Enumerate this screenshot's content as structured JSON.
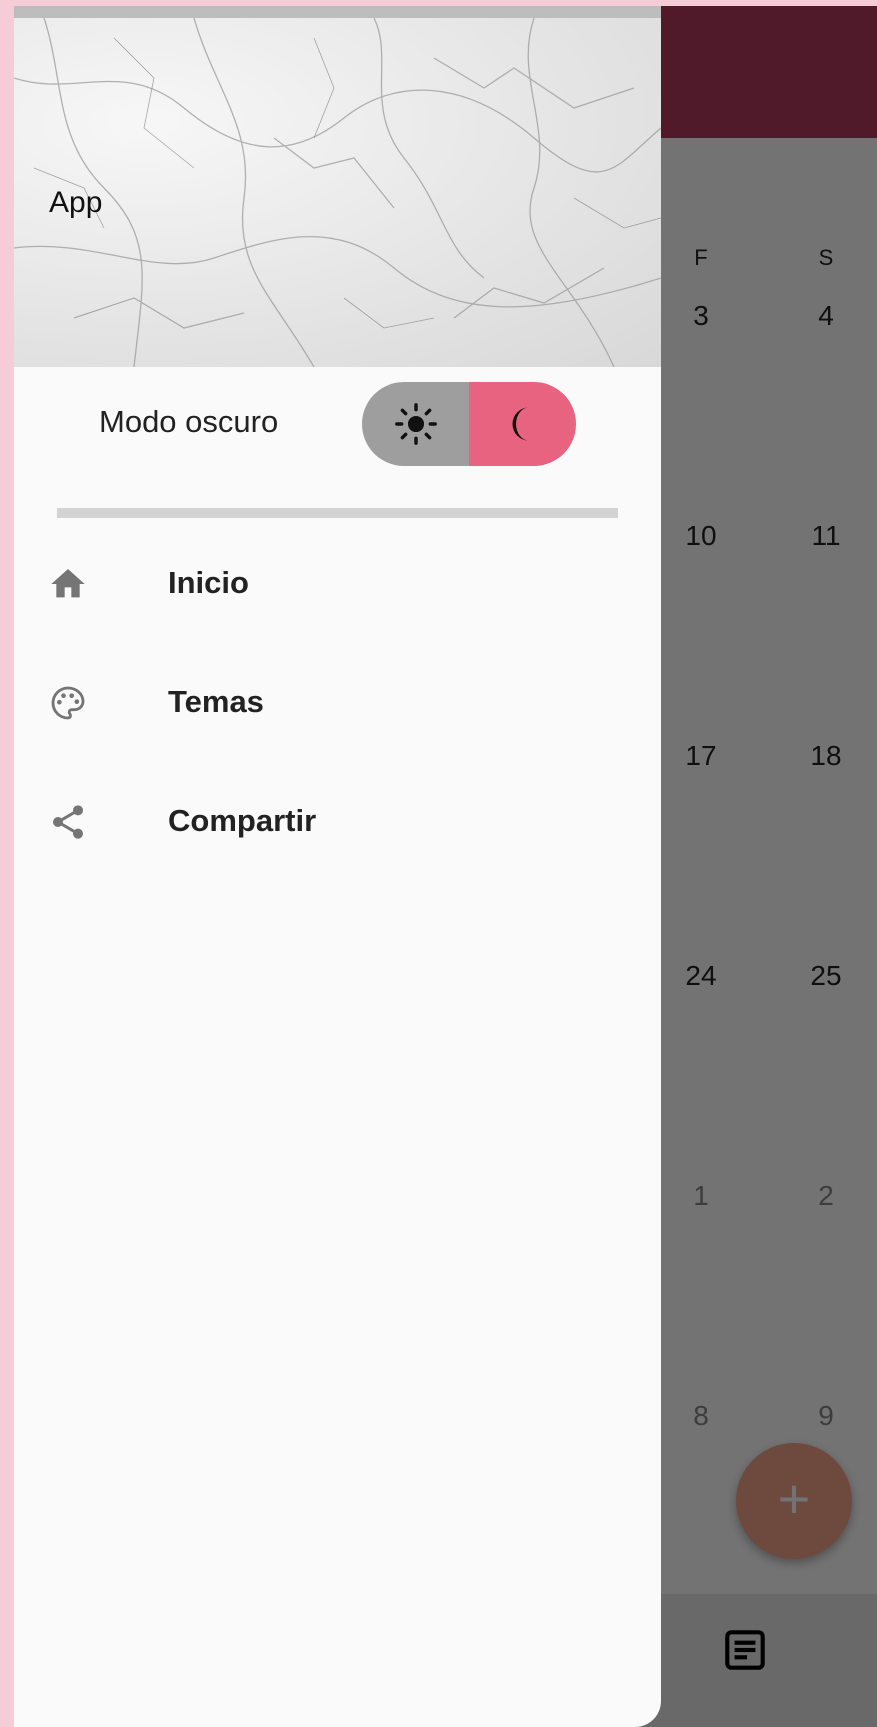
{
  "drawer": {
    "title": "App",
    "dark_mode_label": "Modo oscuro",
    "dark_mode_on": true,
    "menu": [
      {
        "label": "Inicio",
        "icon": "home-icon"
      },
      {
        "label": "Temas",
        "icon": "palette-icon"
      },
      {
        "label": "Compartir",
        "icon": "share-icon"
      }
    ]
  },
  "calendar": {
    "weekdays": [
      "F",
      "S"
    ],
    "rows": [
      [
        "3",
        "4"
      ],
      [
        "10",
        "11"
      ],
      [
        "17",
        "18"
      ],
      [
        "24",
        "25"
      ],
      [
        "1",
        "2"
      ],
      [
        "8",
        "9"
      ]
    ]
  },
  "fab": {
    "label": "+"
  },
  "colors": {
    "appbar": "#b23a5f",
    "toggle_active": "#e8637f",
    "toggle_inactive": "#9e9e9e",
    "fab": "#f4a48a",
    "page_border": "#f6cdd7"
  }
}
